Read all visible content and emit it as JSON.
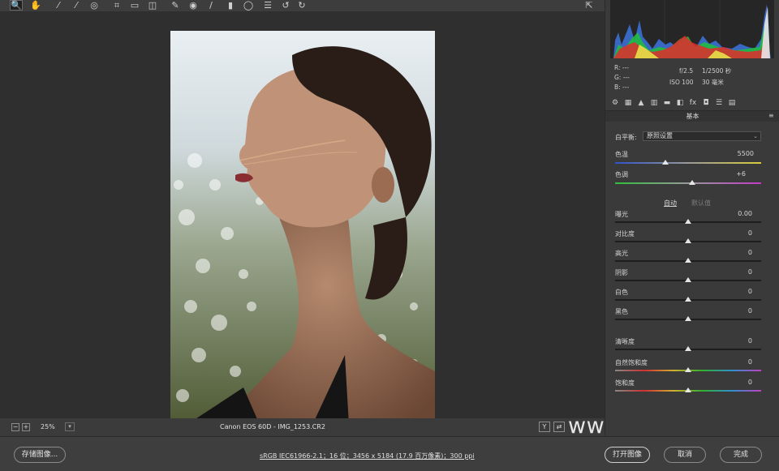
{
  "toolbar": {
    "tools": [
      {
        "name": "zoom-tool-icon",
        "glyph": "🔍"
      },
      {
        "name": "hand-tool-icon",
        "glyph": "✋"
      },
      {
        "name": "white-balance-tool-icon",
        "glyph": "⁄"
      },
      {
        "name": "color-sampler-tool-icon",
        "glyph": "⁄"
      },
      {
        "name": "targeted-adjustment-tool-icon",
        "glyph": "◎"
      },
      {
        "name": "crop-tool-icon",
        "glyph": "⌗"
      },
      {
        "name": "straighten-tool-icon",
        "glyph": "▭"
      },
      {
        "name": "transform-tool-icon",
        "glyph": "◫"
      },
      {
        "name": "spot-removal-tool-icon",
        "glyph": "✎"
      },
      {
        "name": "red-eye-tool-icon",
        "glyph": "◉"
      },
      {
        "name": "adjustment-brush-icon",
        "glyph": "/"
      },
      {
        "name": "graduated-filter-icon",
        "glyph": "▮"
      },
      {
        "name": "radial-filter-icon",
        "glyph": "◯"
      },
      {
        "name": "preferences-icon",
        "glyph": "☰"
      },
      {
        "name": "rotate-ccw-icon",
        "glyph": "↺"
      },
      {
        "name": "rotate-cw-icon",
        "glyph": "↻"
      }
    ],
    "fullscreen_glyph": "⇱"
  },
  "histogram": {
    "readout_r": "R:  ---",
    "readout_g": "G:  ---",
    "readout_b": "B:  ---",
    "aperture": "f/2.5",
    "shutter": "1/2500 秒",
    "iso": "ISO 100",
    "focal": "30 毫米"
  },
  "panel": {
    "tab_glyphs": [
      "⚙",
      "▦",
      "▲",
      "▥",
      "▬",
      "◧",
      "fx",
      "◘",
      "☰",
      "▤"
    ],
    "section_title": "基本",
    "wb_label": "白平衡:",
    "wb_value": "原照设置",
    "temp_label": "色温",
    "temp_value": "5500",
    "tint_label": "色调",
    "tint_value": "+6",
    "auto_label": "自动",
    "default_label": "默认值",
    "sliders": [
      {
        "label": "曝光",
        "value": "0.00"
      },
      {
        "label": "对比度",
        "value": "0"
      },
      {
        "label": "高光",
        "value": "0"
      },
      {
        "label": "阴影",
        "value": "0"
      },
      {
        "label": "白色",
        "value": "0"
      },
      {
        "label": "黑色",
        "value": "0"
      }
    ],
    "presence": [
      {
        "label": "清晰度",
        "value": "0"
      },
      {
        "label": "自然饱和度",
        "value": "0"
      },
      {
        "label": "饱和度",
        "value": "0"
      }
    ]
  },
  "status": {
    "zoom": "25%",
    "filename": "Canon EOS 60D  -  IMG_1253.CR2",
    "minus": "−",
    "plus": "+",
    "view_y": "Y",
    "view_compare": "⇄",
    "watermark": "www.hunls.com"
  },
  "bottom": {
    "save_label": "存储图像...",
    "workflow": "sRGB IEC61966-2.1；16 位；3456 x 5184 (17.9 百万像素)；300 ppi",
    "open_label": "打开图像",
    "cancel_label": "取消",
    "done_label": "完成"
  },
  "colors": {
    "panel_bg": "#3a3a3a",
    "canvas_bg": "#2f2f2f",
    "accent_thumb": "#e6e6e6"
  }
}
